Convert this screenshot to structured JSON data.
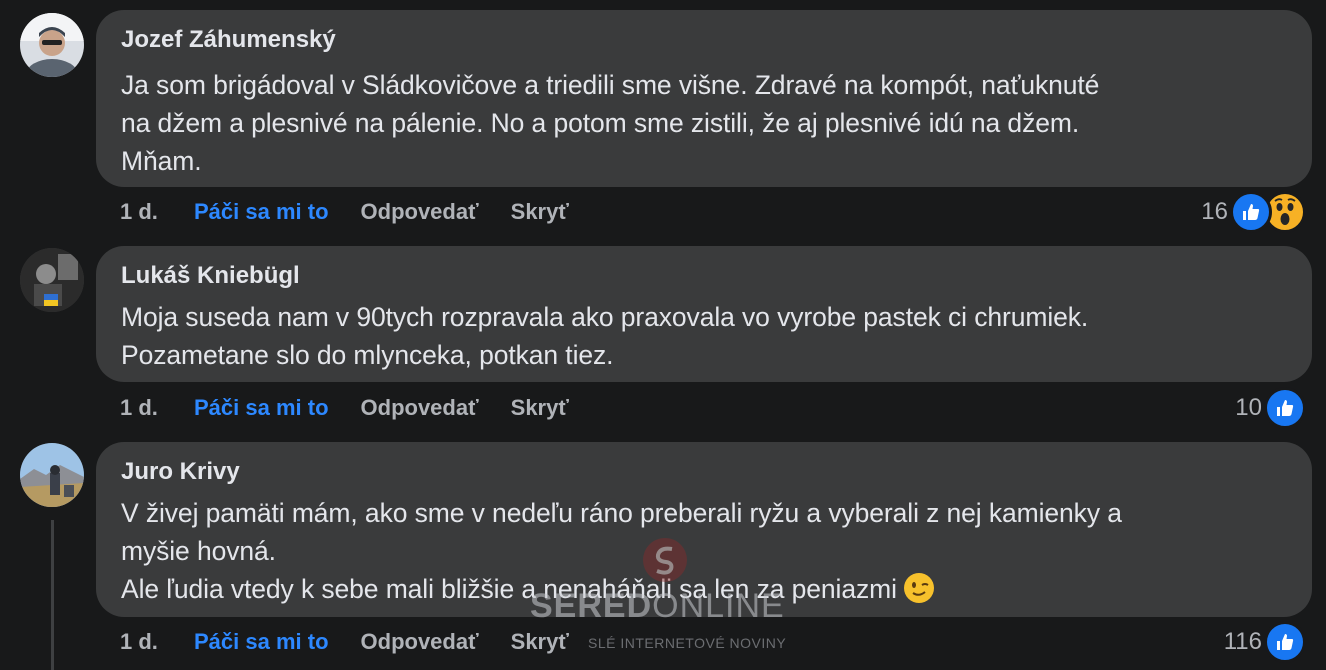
{
  "comments": [
    {
      "author": "Jozef Záhumenský",
      "text": "Ja som brigádoval v Sládkovičove a triedili sme višne. Zdravé na kompót, naťuknuté\nna džem a plesnivé na pálenie. No a potom sme zistili, že aj plesnivé idú na džem.\nMňam.",
      "time": "1 d.",
      "like_label": "Páči sa mi to",
      "reply_label": "Odpovedať",
      "hide_label": "Skryť",
      "reaction_count": "16",
      "reactions": [
        "like-icon",
        "wow-icon"
      ]
    },
    {
      "author": "Lukáš Kniebügl",
      "text": "Moja suseda nam v 90tych rozpravala ako praxovala vo vyrobe pastek ci chrumiek.\nPozametane slo do mlynceka, potkan tiez.",
      "time": "1 d.",
      "like_label": "Páči sa mi to",
      "reply_label": "Odpovedať",
      "hide_label": "Skryť",
      "reaction_count": "10",
      "reactions": [
        "like-icon"
      ]
    },
    {
      "author": "Juro Krivy",
      "text_line1": "V živej pamäti mám, ako sme v nedeľu ráno preberali ryžu a vyberali z nej kamienky a\nmyšie hovná.",
      "text_line2": "Ale ľudia vtedy k sebe mali bližšie a nenaháňali sa len za peniazmi",
      "time": "1 d.",
      "like_label": "Páči sa mi to",
      "reply_label": "Odpovedať",
      "hide_label": "Skryť",
      "reaction_count": "116",
      "reactions": [
        "like-icon"
      ]
    }
  ],
  "watermark": {
    "title_bold": "SERED",
    "title_light": "ONLINE",
    "subtitle": "SLÉ INTERNETOVÉ NOVINY"
  },
  "colors": {
    "background": "#18191a",
    "bubble": "#3a3b3c",
    "like_blue": "#2d88ff",
    "secondary_text": "#b0b3b8"
  }
}
